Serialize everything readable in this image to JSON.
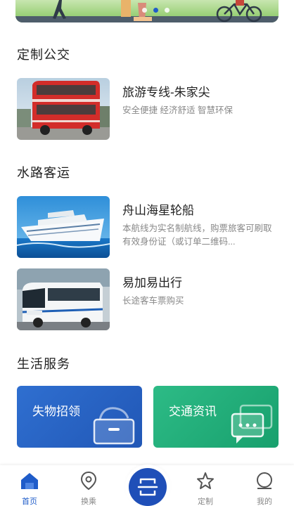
{
  "banner": {
    "active_dot": 1,
    "dot_count": 3
  },
  "sections": {
    "custom_bus": {
      "title": "定制公交",
      "items": [
        {
          "title": "旅游专线-朱家尖",
          "desc": "安全便捷 经济舒适 智慧环保"
        }
      ]
    },
    "water_transport": {
      "title": "水路客运",
      "items": [
        {
          "title": "舟山海星轮船",
          "desc": "本航线为实名制航线，购票旅客可刷取有效身份证（或订单二维码..."
        },
        {
          "title": "易加易出行",
          "desc": "长途客车票购买"
        }
      ]
    },
    "life_services": {
      "title": "生活服务",
      "cards": [
        {
          "label": "失物招领",
          "color": "#2a63c7"
        },
        {
          "label": "交通资讯",
          "color": "#1fae77"
        }
      ]
    }
  },
  "tabbar": {
    "items": [
      {
        "label": "首页",
        "icon": "home-icon",
        "active": true
      },
      {
        "label": "换乘",
        "icon": "location-pin-icon",
        "active": false
      },
      {
        "label": "",
        "icon": "scan-icon",
        "active": false
      },
      {
        "label": "定制",
        "icon": "star-icon",
        "active": false
      },
      {
        "label": "我的",
        "icon": "user-icon",
        "active": false
      }
    ],
    "accent": "#1f5cc9"
  }
}
